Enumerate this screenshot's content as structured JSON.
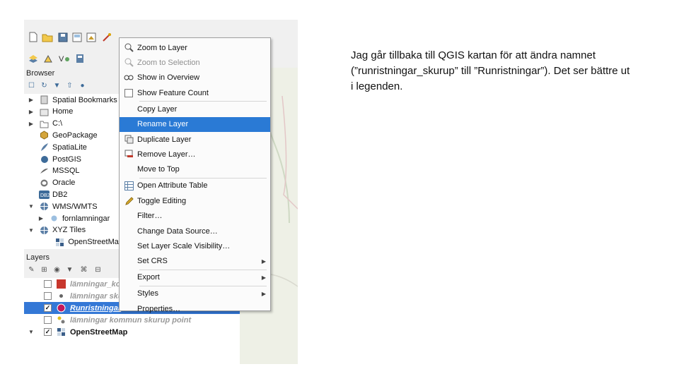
{
  "browser": {
    "title": "Browser",
    "items": [
      {
        "label": "Spatial Bookmarks",
        "arrow": "▶",
        "icon": "bookmark-icon"
      },
      {
        "label": "Home",
        "arrow": "▶",
        "icon": "home-folder-icon"
      },
      {
        "label": "C:\\",
        "arrow": "▶",
        "icon": "drive-folder-icon"
      },
      {
        "label": "GeoPackage",
        "arrow": "",
        "icon": "geopackage-icon"
      },
      {
        "label": "SpatiaLite",
        "arrow": "",
        "icon": "spatialite-feather-icon"
      },
      {
        "label": "PostGIS",
        "arrow": "",
        "icon": "postgis-elephant-icon"
      },
      {
        "label": "MSSQL",
        "arrow": "",
        "icon": "mssql-icon"
      },
      {
        "label": "Oracle",
        "arrow": "",
        "icon": "oracle-icon"
      },
      {
        "label": "DB2",
        "arrow": "",
        "icon": "db2-icon"
      },
      {
        "label": "WMS/WMTS",
        "arrow": "▼",
        "icon": "globe-icon"
      },
      {
        "label": "fornlamningar",
        "arrow": "▶",
        "icon": "wms-layer-icon"
      },
      {
        "label": "XYZ Tiles",
        "arrow": "▼",
        "icon": "globe-icon"
      },
      {
        "label": "OpenStreetMap",
        "arrow": "",
        "icon": "tiles-icon"
      }
    ]
  },
  "layers": {
    "title": "Layers",
    "items": [
      {
        "label": "lämningar_kor",
        "checked": false,
        "symbol": "#c8372d",
        "shape": "square",
        "style": "dim"
      },
      {
        "label": "lämningar sku",
        "checked": false,
        "symbol": "#666666",
        "shape": "dot",
        "style": "dim"
      },
      {
        "label": "Runristningar",
        "checked": true,
        "symbol": "#c2185b",
        "shape": "circle",
        "style": "selected"
      },
      {
        "label": "lämningar kommun skurup point",
        "checked": false,
        "symbol": "#e0c020",
        "shape": "dots",
        "style": "dim"
      },
      {
        "label": "OpenStreetMap",
        "checked": true,
        "symbol": "#3b5f8a",
        "shape": "tiles",
        "style": "normal"
      }
    ]
  },
  "context_menu": {
    "items": [
      {
        "label": "Zoom to Layer",
        "icon": "zoom-layer-icon",
        "state": "normal",
        "submenu": false
      },
      {
        "label": "Zoom to Selection",
        "icon": "zoom-selection-icon",
        "state": "disabled",
        "submenu": false
      },
      {
        "label": "Show in Overview",
        "icon": "overview-icon",
        "state": "normal",
        "submenu": false
      },
      {
        "label": "Show Feature Count",
        "icon": "checkbox-icon",
        "state": "normal",
        "submenu": false
      },
      {
        "label": "Copy Layer",
        "icon": "",
        "state": "normal",
        "submenu": false
      },
      {
        "label": "Rename Layer",
        "icon": "",
        "state": "highlight",
        "submenu": false
      },
      {
        "label": "Duplicate Layer",
        "icon": "duplicate-icon",
        "state": "normal",
        "submenu": false
      },
      {
        "label": "Remove Layer…",
        "icon": "remove-layer-icon",
        "state": "normal",
        "submenu": false
      },
      {
        "label": "Move to Top",
        "icon": "",
        "state": "normal",
        "submenu": false
      },
      {
        "label": "Open Attribute Table",
        "icon": "table-icon",
        "state": "normal",
        "submenu": false
      },
      {
        "label": "Toggle Editing",
        "icon": "pencil-icon",
        "state": "normal",
        "submenu": false
      },
      {
        "label": "Filter…",
        "icon": "",
        "state": "normal",
        "submenu": false
      },
      {
        "label": "Change Data Source…",
        "icon": "",
        "state": "normal",
        "submenu": false
      },
      {
        "label": "Set Layer Scale Visibility…",
        "icon": "",
        "state": "normal",
        "submenu": false
      },
      {
        "label": "Set CRS",
        "icon": "",
        "state": "normal",
        "submenu": true
      },
      {
        "label": "Export",
        "icon": "",
        "state": "normal",
        "submenu": true
      },
      {
        "label": "Styles",
        "icon": "",
        "state": "normal",
        "submenu": true
      },
      {
        "label": "Properties…",
        "icon": "",
        "state": "normal",
        "submenu": false
      }
    ]
  },
  "description": {
    "text": "Jag går tillbaka till QGIS kartan för att ändra namnet (”runristningar_skurup” till ”Runristningar”). Det ser bättre ut i legenden."
  },
  "colors": {
    "selection": "#3478d6",
    "menu_highlight": "#2a7ad5"
  }
}
